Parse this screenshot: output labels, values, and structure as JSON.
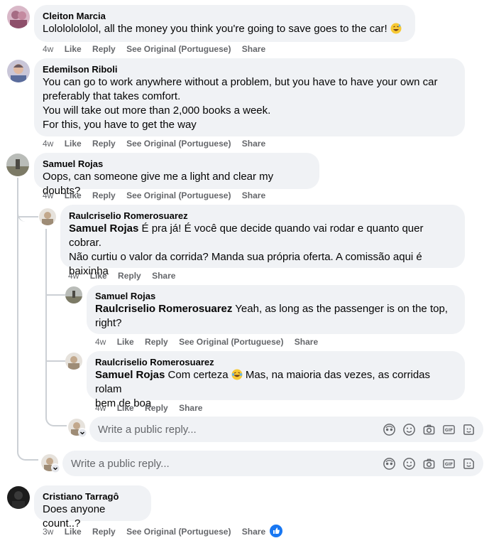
{
  "comments": [
    {
      "name": "Cleiton Marcia",
      "lines": [
        "Lolololololol, all the money you think you're going to save goes to the car!"
      ],
      "actions": {
        "time": "4w",
        "like": "Like",
        "reply": "Reply",
        "see": "See Original (Portuguese)",
        "share": "Share"
      }
    },
    {
      "name": "Edemilson Riboli",
      "lines": [
        "You can go to work anywhere without a problem, but you have to have your own car",
        "preferably that takes comfort.",
        "You will take out more than 2,000 books a week.",
        "For this, you have to get the way"
      ],
      "actions": {
        "time": "4w",
        "like": "Like",
        "reply": "Reply",
        "see": "See Original (Portuguese)",
        "share": "Share"
      }
    },
    {
      "name": "Samuel Rojas",
      "lines": [
        "Oops, can someone give me a light and clear my doubts?"
      ],
      "actions": {
        "time": "4w",
        "like": "Like",
        "reply": "Reply",
        "see": "See Original (Portuguese)",
        "share": "Share"
      }
    },
    {
      "name": "Raulcriselio Romerosuarez",
      "tag": "Samuel Rojas",
      "lines": [
        " É pra já! É você que decide quando vai rodar e quanto quer cobrar.",
        "Não curtiu o valor da corrida? Manda sua própria oferta. A comissão aqui é",
        "baixinha"
      ],
      "actions": {
        "time": "4w",
        "like": "Like",
        "reply": "Reply",
        "share": "Share"
      }
    },
    {
      "name": "Samuel Rojas",
      "tag": "Raulcriselio Romerosuarez",
      "lines": [
        " Yeah, as long as the passenger is on the top,",
        "right?"
      ],
      "actions": {
        "time": "4w",
        "like": "Like",
        "reply": "Reply",
        "see": "See Original (Portuguese)",
        "share": "Share"
      }
    },
    {
      "name": "Raulcriselio Romerosuarez",
      "tag": "Samuel Rojas",
      "lines": [
        " Com certeza",
        " Mas, na maioria das vezes, as corridas rolam",
        "bem de boa"
      ],
      "actions": {
        "time": "4w",
        "like": "Like",
        "reply": "Reply",
        "share": "Share"
      }
    },
    {
      "name": "Cristiano Tarragô",
      "lines": [
        "Does anyone count..?"
      ],
      "actions": {
        "time": "3w",
        "like": "Like",
        "reply": "Reply",
        "see": "See Original (Portuguese)",
        "share": "Share"
      }
    }
  ],
  "reply_boxes": [
    {
      "placeholder": "Write a public reply..."
    },
    {
      "placeholder": "Write a public reply..."
    }
  ],
  "reply_tools": [
    "avatar-sticker-icon",
    "emoji-icon",
    "camera-icon",
    "gif-icon",
    "sticker-icon"
  ],
  "colors": {
    "bubble": "#f0f2f5",
    "meta": "#65676b",
    "like_blue": "#1877f2",
    "thread_line": "#ccd0d5"
  }
}
